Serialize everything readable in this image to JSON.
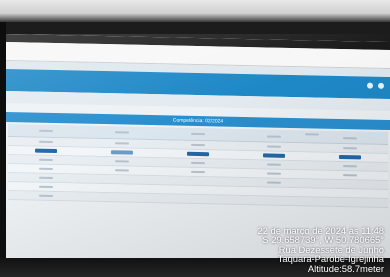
{
  "screen": {
    "section_title": "Competência: 02/2024",
    "columns": [
      "",
      "",
      "",
      ""
    ],
    "group_header": ""
  },
  "overlay": {
    "line1": "22 de março de 2024 às 11:48",
    "line2": "S 29.658739°, W 50.780665°",
    "line3": "Rua Dezessete de Junho",
    "line4": "Taquara-Parobé-Igrejinha",
    "line5": "Altitude:58.7meter"
  },
  "colors": {
    "header_blue": "#1e88c7",
    "section_blue": "#2a8fce",
    "highlight_blue": "#2468a8"
  }
}
